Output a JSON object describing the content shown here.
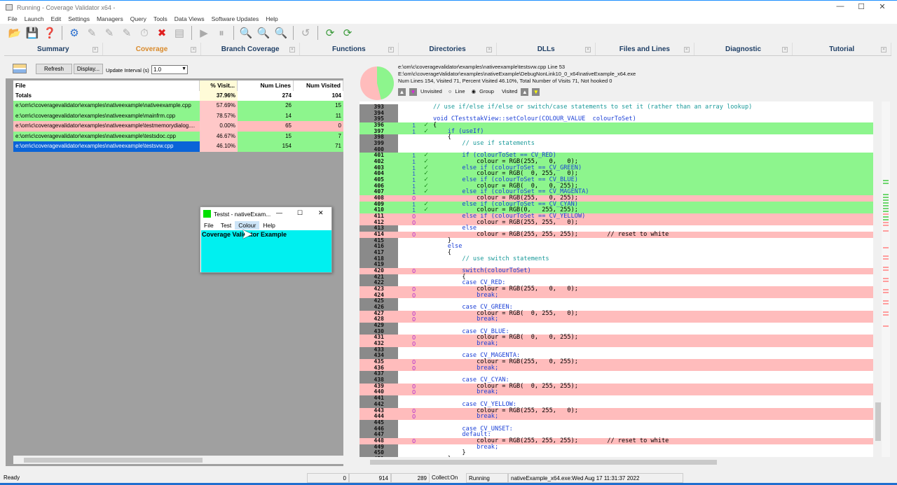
{
  "window": {
    "title": "Running - Coverage Validator x64 -",
    "minimize": "—",
    "maximize": "☐",
    "close": "✕"
  },
  "menu": [
    "File",
    "Launch",
    "Edit",
    "Settings",
    "Managers",
    "Query",
    "Tools",
    "Data Views",
    "Software Updates",
    "Help"
  ],
  "toolbar": [
    {
      "icon": "open-icon",
      "g": "📂"
    },
    {
      "icon": "save-icon",
      "g": "💾"
    },
    {
      "icon": "help-icon",
      "g": "❓"
    },
    {
      "sep": true
    },
    {
      "icon": "settings-gear-icon",
      "g": "⚙"
    },
    {
      "icon": "launch-icon",
      "g": "✎"
    },
    {
      "icon": "inject-icon",
      "g": "✎"
    },
    {
      "icon": "wait-icon",
      "g": "✎"
    },
    {
      "icon": "stopwatch-icon",
      "g": "⏱"
    },
    {
      "icon": "stop-icon",
      "g": "✖"
    },
    {
      "icon": "printer-icon",
      "g": "▤"
    },
    {
      "sep": true
    },
    {
      "icon": "play-icon",
      "g": "▶"
    },
    {
      "icon": "pause-icon",
      "g": "⏸"
    },
    {
      "sep": true
    },
    {
      "icon": "zoom-hex-icon",
      "g": "🔍"
    },
    {
      "icon": "zoom-icon",
      "g": "🔍"
    },
    {
      "icon": "zoom-reset-icon",
      "g": "🔍"
    },
    {
      "sep": true
    },
    {
      "icon": "undo-icon",
      "g": "↺"
    },
    {
      "sep": true
    },
    {
      "icon": "refresh-icon",
      "g": "⟳"
    },
    {
      "icon": "refresh-all-icon",
      "g": "⟳"
    }
  ],
  "tabs": [
    {
      "label": "Summary"
    },
    {
      "label": "Coverage",
      "active": true
    },
    {
      "label": "Branch Coverage"
    },
    {
      "label": "Functions"
    },
    {
      "label": "Directories"
    },
    {
      "label": "DLLs"
    },
    {
      "label": "Files and Lines"
    },
    {
      "label": "Diagnostic"
    },
    {
      "label": "Tutorial"
    }
  ],
  "controls": {
    "refresh": "Refresh",
    "display": "Display...",
    "interval_label": "Update Interval (s)",
    "interval_value": "1.0"
  },
  "table": {
    "headers": [
      "File",
      "% Visit...",
      "Num Lines",
      "Num Visited"
    ],
    "totals": {
      "label": "Totals",
      "percent": "37.96%",
      "lines": "274",
      "visited": "104"
    },
    "rows": [
      {
        "file": "e:\\om\\c\\coveragevalidator\\examples\\nativeexample\\nativeexample.cpp",
        "percent": "57.69%",
        "pct": 57.69,
        "lines": "26",
        "visited": "15",
        "status": "visited"
      },
      {
        "file": "e:\\om\\c\\coveragevalidator\\examples\\nativeexample\\mainfrm.cpp",
        "percent": "78.57%",
        "pct": 78.57,
        "lines": "14",
        "visited": "11",
        "status": "visited"
      },
      {
        "file": "e:\\om\\c\\coveragevalidator\\examples\\nativeexample\\testmemorydialog....",
        "percent": "0.00%",
        "pct": 0,
        "lines": "65",
        "visited": "0",
        "status": "unvisited"
      },
      {
        "file": "e:\\om\\c\\coveragevalidator\\examples\\nativeexample\\testsdoc.cpp",
        "percent": "46.67%",
        "pct": 46.67,
        "lines": "15",
        "visited": "7",
        "status": "visited"
      },
      {
        "file": "e:\\om\\c\\coveragevalidator\\examples\\nativeexample\\testsvw.cpp",
        "percent": "46.10%",
        "pct": 46.1,
        "lines": "154",
        "visited": "71",
        "status": "selected"
      }
    ]
  },
  "info": {
    "line1": "e:\\om\\c\\coveragevalidator\\examples\\nativeexample\\testsvw.cpp Line 53",
    "line2": "E:\\om\\c\\coverageValidator\\examples\\nativeExample\\DebugNonLink10_0_x64\\nativeExample_x64.exe",
    "line3": "Num Lines   154, Visited    71, Percent Visited 46.10%, Total Number of Visits       71, Not hooked 0",
    "unvisited": "Unvisited",
    "line": "Line",
    "group": "Group",
    "visited": "Visited",
    "pie_visited_percent": 46.1
  },
  "colors": {
    "visited": "#8df58d",
    "unvisited": "#ffbcbc",
    "selected": "#0a64d8",
    "accent_tab": "#d98a2b"
  },
  "code": [
    {
      "n": "393",
      "c": "",
      "s": "none",
      "t": "// use if/else if/else or switch/case statements to set it (rather than an array lookup)"
    },
    {
      "n": "394",
      "c": "",
      "s": "none",
      "t": ""
    },
    {
      "n": "395",
      "c": "",
      "s": "none",
      "t": "void CTeststakView::setColour(COLOUR_VALUE  colourToSet)"
    },
    {
      "n": "396",
      "c": "1",
      "s": "visited",
      "t": "{"
    },
    {
      "n": "397",
      "c": "1",
      "s": "visited",
      "t": "    if (useIf)"
    },
    {
      "n": "398",
      "c": "",
      "s": "none",
      "t": "    {"
    },
    {
      "n": "399",
      "c": "",
      "s": "none",
      "t": "        // use if statements"
    },
    {
      "n": "400",
      "c": "",
      "s": "none",
      "t": ""
    },
    {
      "n": "401",
      "c": "1",
      "s": "visited",
      "t": "        if (colourToSet == CV_RED)"
    },
    {
      "n": "402",
      "c": "1",
      "s": "visited",
      "t": "            colour = RGB(255,   0,   0);"
    },
    {
      "n": "403",
      "c": "1",
      "s": "visited",
      "t": "        else if (colourToSet == CV_GREEN)"
    },
    {
      "n": "404",
      "c": "1",
      "s": "visited",
      "t": "            colour = RGB(  0, 255,   0);"
    },
    {
      "n": "405",
      "c": "1",
      "s": "visited",
      "t": "        else if (colourToSet == CV_BLUE)"
    },
    {
      "n": "406",
      "c": "1",
      "s": "visited",
      "t": "            colour = RGB(  0,   0, 255);"
    },
    {
      "n": "407",
      "c": "1",
      "s": "visited",
      "t": "        else if (colourToSet == CV_MAGENTA)"
    },
    {
      "n": "408",
      "c": "0",
      "s": "unvisited",
      "t": "            colour = RGB(255,   0, 255);"
    },
    {
      "n": "409",
      "c": "1",
      "s": "visited",
      "t": "        else if (colourToSet == CV_CYAN)"
    },
    {
      "n": "410",
      "c": "1",
      "s": "visited",
      "t": "            colour = RGB(0,   255, 255);"
    },
    {
      "n": "411",
      "c": "0",
      "s": "unvisited",
      "t": "        else if (colourToSet == CV_YELLOW)"
    },
    {
      "n": "412",
      "c": "0",
      "s": "unvisited",
      "t": "            colour = RGB(255, 255,   0);"
    },
    {
      "n": "413",
      "c": "",
      "s": "none",
      "t": "        else"
    },
    {
      "n": "414",
      "c": "0",
      "s": "unvisited",
      "t": "            colour = RGB(255, 255, 255);        // reset to white"
    },
    {
      "n": "415",
      "c": "",
      "s": "none",
      "t": "    }"
    },
    {
      "n": "416",
      "c": "",
      "s": "none",
      "t": "    else"
    },
    {
      "n": "417",
      "c": "",
      "s": "none",
      "t": "    {"
    },
    {
      "n": "418",
      "c": "",
      "s": "none",
      "t": "        // use switch statements"
    },
    {
      "n": "419",
      "c": "",
      "s": "none",
      "t": ""
    },
    {
      "n": "420",
      "c": "0",
      "s": "unvisited",
      "t": "        switch(colourToSet)"
    },
    {
      "n": "421",
      "c": "",
      "s": "none",
      "t": "        {"
    },
    {
      "n": "422",
      "c": "",
      "s": "none",
      "t": "        case CV_RED:"
    },
    {
      "n": "423",
      "c": "0",
      "s": "unvisited",
      "t": "            colour = RGB(255,   0,   0);"
    },
    {
      "n": "424",
      "c": "0",
      "s": "unvisited",
      "t": "            break;"
    },
    {
      "n": "425",
      "c": "",
      "s": "none",
      "t": ""
    },
    {
      "n": "426",
      "c": "",
      "s": "none",
      "t": "        case CV_GREEN:"
    },
    {
      "n": "427",
      "c": "0",
      "s": "unvisited",
      "t": "            colour = RGB(  0, 255,   0);"
    },
    {
      "n": "428",
      "c": "0",
      "s": "unvisited",
      "t": "            break;"
    },
    {
      "n": "429",
      "c": "",
      "s": "none",
      "t": ""
    },
    {
      "n": "430",
      "c": "",
      "s": "none",
      "t": "        case CV_BLUE:"
    },
    {
      "n": "431",
      "c": "0",
      "s": "unvisited",
      "t": "            colour = RGB(  0,   0, 255);"
    },
    {
      "n": "432",
      "c": "0",
      "s": "unvisited",
      "t": "            break;"
    },
    {
      "n": "433",
      "c": "",
      "s": "none",
      "t": ""
    },
    {
      "n": "434",
      "c": "",
      "s": "none",
      "t": "        case CV_MAGENTA:"
    },
    {
      "n": "435",
      "c": "0",
      "s": "unvisited",
      "t": "            colour = RGB(255,   0, 255);"
    },
    {
      "n": "436",
      "c": "0",
      "s": "unvisited",
      "t": "            break;"
    },
    {
      "n": "437",
      "c": "",
      "s": "none",
      "t": ""
    },
    {
      "n": "438",
      "c": "",
      "s": "none",
      "t": "        case CV_CYAN:"
    },
    {
      "n": "439",
      "c": "0",
      "s": "unvisited",
      "t": "            colour = RGB(  0, 255, 255);"
    },
    {
      "n": "440",
      "c": "0",
      "s": "unvisited",
      "t": "            break;"
    },
    {
      "n": "441",
      "c": "",
      "s": "none",
      "t": ""
    },
    {
      "n": "442",
      "c": "",
      "s": "none",
      "t": "        case CV_YELLOW:"
    },
    {
      "n": "443",
      "c": "0",
      "s": "unvisited",
      "t": "            colour = RGB(255, 255,   0);"
    },
    {
      "n": "444",
      "c": "0",
      "s": "unvisited",
      "t": "            break;"
    },
    {
      "n": "445",
      "c": "",
      "s": "none",
      "t": ""
    },
    {
      "n": "446",
      "c": "",
      "s": "none",
      "t": "        case CV_UNSET:"
    },
    {
      "n": "447",
      "c": "",
      "s": "none",
      "t": "        default:"
    },
    {
      "n": "448",
      "c": "0",
      "s": "unvisited",
      "t": "            colour = RGB(255, 255, 255);        // reset to white"
    },
    {
      "n": "449",
      "c": "",
      "s": "none",
      "t": "            break;"
    },
    {
      "n": "450",
      "c": "",
      "s": "none",
      "t": "        }"
    },
    {
      "n": "451",
      "c": "",
      "s": "none",
      "t": "    }"
    }
  ],
  "popup": {
    "title": "Testst - nativeExam...",
    "menu": [
      "File",
      "Test",
      "Colour",
      "Help"
    ],
    "body": "Coverage Validator Example",
    "minimize": "—",
    "maximize": "☐",
    "close": "✕"
  },
  "status": {
    "ready": "Ready",
    "s1": "0",
    "s2": "914",
    "s3": "289",
    "collect": "Collect:On",
    "state": "Running",
    "process": "nativeExample_x64.exe:Wed Aug 17 11:31:37 2022"
  }
}
